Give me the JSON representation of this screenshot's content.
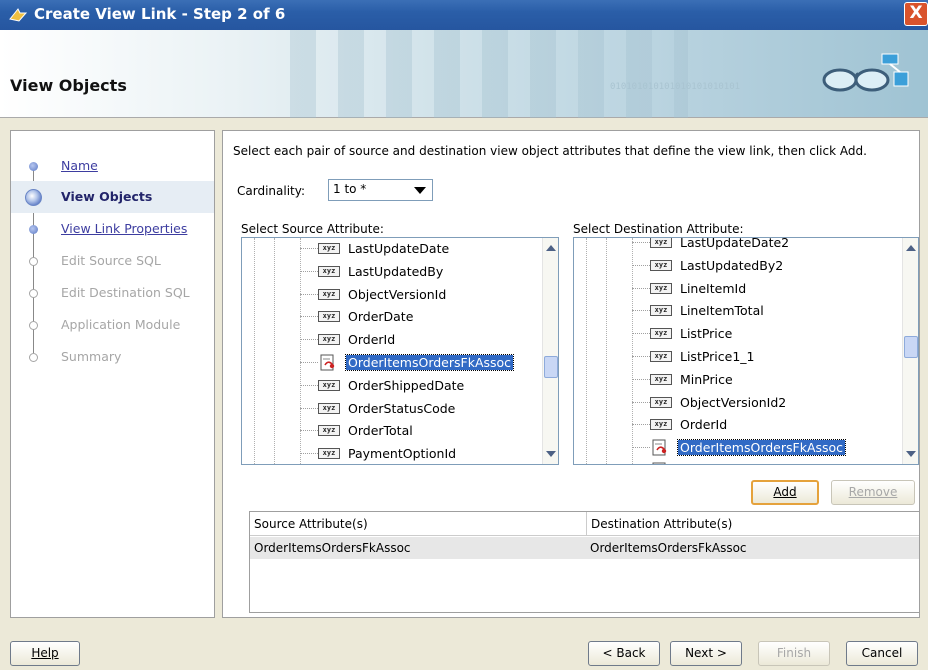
{
  "window": {
    "title": "Create View Link - Step 2 of 6",
    "close_label": "X"
  },
  "header": {
    "title": "View Objects",
    "binary_text": "010101010101010101010101"
  },
  "steps": [
    {
      "label": "Name",
      "state": "done"
    },
    {
      "label": "View Objects",
      "state": "current"
    },
    {
      "label": "View Link Properties",
      "state": "done"
    },
    {
      "label": "Edit Source SQL",
      "state": "todo"
    },
    {
      "label": "Edit Destination SQL",
      "state": "todo"
    },
    {
      "label": "Application Module",
      "state": "todo"
    },
    {
      "label": "Summary",
      "state": "todo"
    }
  ],
  "main": {
    "instruction": "Select each pair of source and destination view object attributes that define the view link, then click Add.",
    "cardinality_label": "Cardinality:",
    "cardinality_value": "1 to *",
    "source_label": "Select Source Attribute:",
    "destination_label": "Select Destination Attribute:",
    "source_items": [
      {
        "text": "LastUpdateDate",
        "icon": "xyz-attribute-icon"
      },
      {
        "text": "LastUpdatedBy",
        "icon": "xyz-attribute-icon"
      },
      {
        "text": "ObjectVersionId",
        "icon": "xyz-attribute-icon"
      },
      {
        "text": "OrderDate",
        "icon": "xyz-attribute-icon"
      },
      {
        "text": "OrderId",
        "icon": "xyz-attribute-icon"
      },
      {
        "text": "OrderItemsOrdersFkAssoc",
        "icon": "association-icon",
        "selected": true
      },
      {
        "text": "OrderShippedDate",
        "icon": "xyz-attribute-icon"
      },
      {
        "text": "OrderStatusCode",
        "icon": "xyz-attribute-icon"
      },
      {
        "text": "OrderTotal",
        "icon": "xyz-attribute-icon"
      },
      {
        "text": "PaymentOptionId",
        "icon": "xyz-attribute-icon"
      }
    ],
    "destination_items": [
      {
        "text": "LastUpdateDate2",
        "icon": "xyz-attribute-icon"
      },
      {
        "text": "LastUpdatedBy2",
        "icon": "xyz-attribute-icon"
      },
      {
        "text": "LineItemId",
        "icon": "xyz-attribute-icon"
      },
      {
        "text": "LineItemTotal",
        "icon": "xyz-attribute-icon"
      },
      {
        "text": "ListPrice",
        "icon": "xyz-attribute-icon"
      },
      {
        "text": "ListPrice1_1",
        "icon": "xyz-attribute-icon"
      },
      {
        "text": "MinPrice",
        "icon": "xyz-attribute-icon"
      },
      {
        "text": "ObjectVersionId2",
        "icon": "xyz-attribute-icon"
      },
      {
        "text": "OrderId",
        "icon": "xyz-attribute-icon"
      },
      {
        "text": "OrderItemsOrdersFkAssoc",
        "icon": "association-icon",
        "selected": true
      },
      {
        "text": "OrderStorageProductsFkAssoc",
        "icon": "association-icon"
      }
    ],
    "xyz_text": "xyz",
    "add_label": "Add",
    "remove_label": "Remove",
    "table_headers": [
      "Source Attribute(s)",
      "Destination Attribute(s)"
    ],
    "table_rows": [
      [
        "OrderItemsOrdersFkAssoc",
        "OrderItemsOrdersFkAssoc"
      ]
    ]
  },
  "footer": {
    "help": "Help",
    "back": "< Back",
    "next": "Next >",
    "finish": "Finish",
    "cancel": "Cancel"
  },
  "colors": {
    "title_bar": "#2a5ea8",
    "selection": "#316ac5",
    "default_button_border": "#e5a23c"
  }
}
